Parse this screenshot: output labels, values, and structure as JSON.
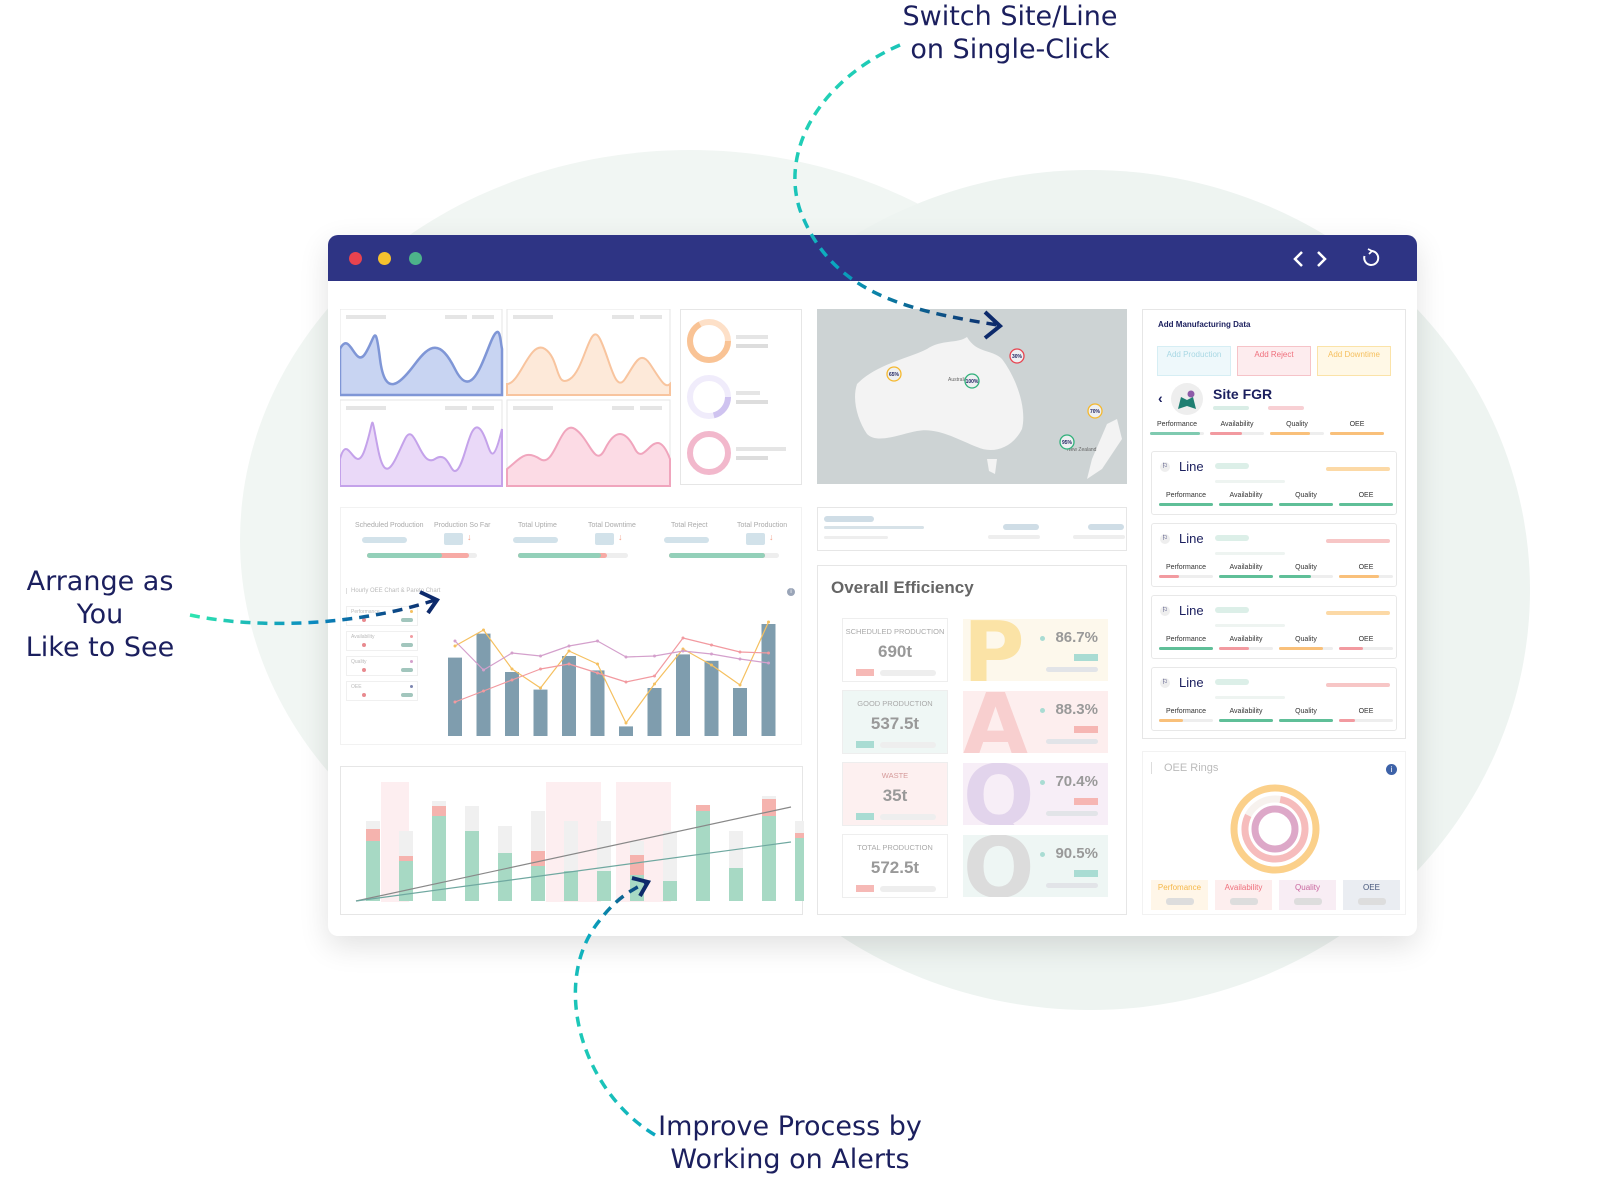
{
  "callouts": {
    "switch": [
      "Switch Site/Line",
      "on Single-Click"
    ],
    "arrange": [
      "Arrange as You",
      "Like to See"
    ],
    "improve": [
      "Improve Process by",
      "Working on Alerts"
    ]
  },
  "titlebar": {
    "icons": [
      "close-dot",
      "minimize-dot",
      "maximize-dot",
      "chevron-left-icon",
      "chevron-right-icon",
      "refresh-icon"
    ],
    "colors": {
      "bar": "#2e3484",
      "red": "#e8434f",
      "yellow": "#f5c12e",
      "green": "#4db38a"
    }
  },
  "summary": {
    "labels": [
      "Scheduled Production",
      "Production So Far",
      "Total Uptime",
      "Total Downtime",
      "Total Reject",
      "Total Production"
    ],
    "progress": [
      {
        "good": 68,
        "bad": 25
      },
      {
        "good": 75,
        "bad": 6
      },
      {
        "good": 87,
        "bad": 0
      }
    ]
  },
  "hourly_chart": {
    "title": "Hourly OEE Chart & Pareto Chart",
    "legend": [
      "Performance",
      "Availability",
      "Quality",
      "OEE"
    ],
    "bars": [
      49,
      64,
      40,
      29,
      50,
      41,
      6,
      30,
      51,
      47,
      30,
      70
    ]
  },
  "map": {
    "markers": [
      {
        "label": "65%",
        "color": "#f5b82e"
      },
      {
        "label": "100%",
        "color": "#2fb07a"
      },
      {
        "label": "30%",
        "color": "#e8434f"
      },
      {
        "label": "70%",
        "color": "#f5b82e"
      },
      {
        "label": "95%",
        "color": "#2fb07a"
      }
    ],
    "places": [
      "Australia",
      "New Zealand"
    ]
  },
  "efficiency": {
    "title": "Overall Efficiency",
    "boxes": [
      {
        "label": "SCHEDULED PRODUCTION",
        "value": "690t"
      },
      {
        "label": "GOOD PRODUCTION",
        "value": "537.5t"
      },
      {
        "label": "WASTE",
        "value": "35t"
      },
      {
        "label": "TOTAL PRODUCTION",
        "value": "572.5t"
      }
    ],
    "letters": [
      {
        "letter": "P",
        "value": "86.7%"
      },
      {
        "letter": "A",
        "value": "88.3%"
      },
      {
        "letter": "Q",
        "value": "70.4%"
      },
      {
        "letter": "O",
        "value": "90.5%"
      }
    ]
  },
  "manufacturing": {
    "title": "Add Manufacturing Data",
    "buttons": [
      "Add Production",
      "Add Reject",
      "Add Downtime"
    ],
    "site": "Site FGR",
    "metrics": [
      "Performance",
      "Availability",
      "Quality",
      "OEE"
    ],
    "lines": [
      "Line",
      "Line",
      "Line",
      "Line"
    ]
  },
  "rings": {
    "title": "OEE Rings",
    "legend": [
      "Perfomance",
      "Availability",
      "Quality",
      "OEE"
    ],
    "values": [
      92,
      80,
      100
    ]
  }
}
